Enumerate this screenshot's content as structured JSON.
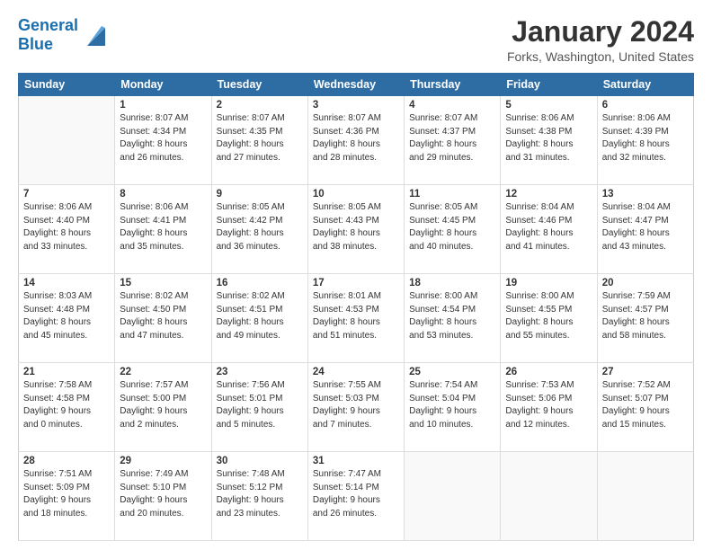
{
  "header": {
    "logo_line1": "General",
    "logo_line2": "Blue",
    "title": "January 2024",
    "subtitle": "Forks, Washington, United States"
  },
  "calendar": {
    "days_of_week": [
      "Sunday",
      "Monday",
      "Tuesday",
      "Wednesday",
      "Thursday",
      "Friday",
      "Saturday"
    ],
    "weeks": [
      [
        {
          "num": "",
          "info": ""
        },
        {
          "num": "1",
          "info": "Sunrise: 8:07 AM\nSunset: 4:34 PM\nDaylight: 8 hours\nand 26 minutes."
        },
        {
          "num": "2",
          "info": "Sunrise: 8:07 AM\nSunset: 4:35 PM\nDaylight: 8 hours\nand 27 minutes."
        },
        {
          "num": "3",
          "info": "Sunrise: 8:07 AM\nSunset: 4:36 PM\nDaylight: 8 hours\nand 28 minutes."
        },
        {
          "num": "4",
          "info": "Sunrise: 8:07 AM\nSunset: 4:37 PM\nDaylight: 8 hours\nand 29 minutes."
        },
        {
          "num": "5",
          "info": "Sunrise: 8:06 AM\nSunset: 4:38 PM\nDaylight: 8 hours\nand 31 minutes."
        },
        {
          "num": "6",
          "info": "Sunrise: 8:06 AM\nSunset: 4:39 PM\nDaylight: 8 hours\nand 32 minutes."
        }
      ],
      [
        {
          "num": "7",
          "info": "Sunrise: 8:06 AM\nSunset: 4:40 PM\nDaylight: 8 hours\nand 33 minutes."
        },
        {
          "num": "8",
          "info": "Sunrise: 8:06 AM\nSunset: 4:41 PM\nDaylight: 8 hours\nand 35 minutes."
        },
        {
          "num": "9",
          "info": "Sunrise: 8:05 AM\nSunset: 4:42 PM\nDaylight: 8 hours\nand 36 minutes."
        },
        {
          "num": "10",
          "info": "Sunrise: 8:05 AM\nSunset: 4:43 PM\nDaylight: 8 hours\nand 38 minutes."
        },
        {
          "num": "11",
          "info": "Sunrise: 8:05 AM\nSunset: 4:45 PM\nDaylight: 8 hours\nand 40 minutes."
        },
        {
          "num": "12",
          "info": "Sunrise: 8:04 AM\nSunset: 4:46 PM\nDaylight: 8 hours\nand 41 minutes."
        },
        {
          "num": "13",
          "info": "Sunrise: 8:04 AM\nSunset: 4:47 PM\nDaylight: 8 hours\nand 43 minutes."
        }
      ],
      [
        {
          "num": "14",
          "info": "Sunrise: 8:03 AM\nSunset: 4:48 PM\nDaylight: 8 hours\nand 45 minutes."
        },
        {
          "num": "15",
          "info": "Sunrise: 8:02 AM\nSunset: 4:50 PM\nDaylight: 8 hours\nand 47 minutes."
        },
        {
          "num": "16",
          "info": "Sunrise: 8:02 AM\nSunset: 4:51 PM\nDaylight: 8 hours\nand 49 minutes."
        },
        {
          "num": "17",
          "info": "Sunrise: 8:01 AM\nSunset: 4:53 PM\nDaylight: 8 hours\nand 51 minutes."
        },
        {
          "num": "18",
          "info": "Sunrise: 8:00 AM\nSunset: 4:54 PM\nDaylight: 8 hours\nand 53 minutes."
        },
        {
          "num": "19",
          "info": "Sunrise: 8:00 AM\nSunset: 4:55 PM\nDaylight: 8 hours\nand 55 minutes."
        },
        {
          "num": "20",
          "info": "Sunrise: 7:59 AM\nSunset: 4:57 PM\nDaylight: 8 hours\nand 58 minutes."
        }
      ],
      [
        {
          "num": "21",
          "info": "Sunrise: 7:58 AM\nSunset: 4:58 PM\nDaylight: 9 hours\nand 0 minutes."
        },
        {
          "num": "22",
          "info": "Sunrise: 7:57 AM\nSunset: 5:00 PM\nDaylight: 9 hours\nand 2 minutes."
        },
        {
          "num": "23",
          "info": "Sunrise: 7:56 AM\nSunset: 5:01 PM\nDaylight: 9 hours\nand 5 minutes."
        },
        {
          "num": "24",
          "info": "Sunrise: 7:55 AM\nSunset: 5:03 PM\nDaylight: 9 hours\nand 7 minutes."
        },
        {
          "num": "25",
          "info": "Sunrise: 7:54 AM\nSunset: 5:04 PM\nDaylight: 9 hours\nand 10 minutes."
        },
        {
          "num": "26",
          "info": "Sunrise: 7:53 AM\nSunset: 5:06 PM\nDaylight: 9 hours\nand 12 minutes."
        },
        {
          "num": "27",
          "info": "Sunrise: 7:52 AM\nSunset: 5:07 PM\nDaylight: 9 hours\nand 15 minutes."
        }
      ],
      [
        {
          "num": "28",
          "info": "Sunrise: 7:51 AM\nSunset: 5:09 PM\nDaylight: 9 hours\nand 18 minutes."
        },
        {
          "num": "29",
          "info": "Sunrise: 7:49 AM\nSunset: 5:10 PM\nDaylight: 9 hours\nand 20 minutes."
        },
        {
          "num": "30",
          "info": "Sunrise: 7:48 AM\nSunset: 5:12 PM\nDaylight: 9 hours\nand 23 minutes."
        },
        {
          "num": "31",
          "info": "Sunrise: 7:47 AM\nSunset: 5:14 PM\nDaylight: 9 hours\nand 26 minutes."
        },
        {
          "num": "",
          "info": ""
        },
        {
          "num": "",
          "info": ""
        },
        {
          "num": "",
          "info": ""
        }
      ]
    ]
  }
}
